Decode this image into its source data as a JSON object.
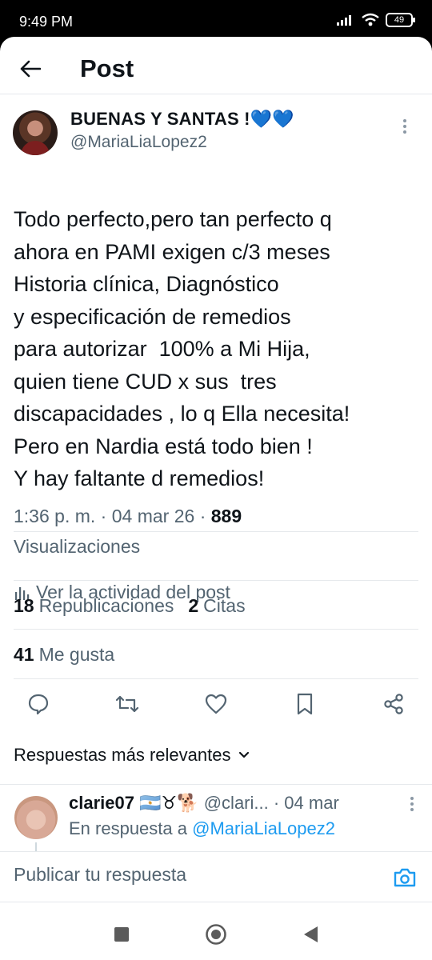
{
  "status_bar": {
    "time": "9:49 PM",
    "battery": "49"
  },
  "header": {
    "title": "Post"
  },
  "post": {
    "author_name": "BUENAS Y SANTAS !💙💙",
    "author_handle": "@MariaLiaLopez2",
    "text_lines": [
      "Todo perfecto,pero tan perfecto q",
      "ahora en PAMI exigen c/3 meses",
      "Historia clínica, Diagnóstico",
      "y especificación de remedios",
      "para autorizar  100% a Mi Hija,",
      "quien tiene CUD x sus  tres",
      "discapacidades , lo q Ella necesita!",
      "Pero en Nardia está todo bien !",
      "Y hay faltante d remedios!"
    ],
    "time": "1:36 p. m.",
    "date": "04 mar 26",
    "views_count": "889",
    "views_label": "Visualizaciones",
    "activity_label": "Ver la actividad del post",
    "reposts_count": "18",
    "reposts_label": "Republicaciones",
    "quotes_count": "2",
    "quotes_label": "Citas",
    "likes_count": "41",
    "likes_label": "Me gusta"
  },
  "replies": {
    "sort_label": "Respuestas más relevantes",
    "items": [
      {
        "name": "clarie07 🇦🇷♉🐕",
        "handle": "@clari...",
        "date": "· 04 mar",
        "reply_prefix": "En respuesta a",
        "reply_to": "@MariaLiaLopez2"
      }
    ]
  },
  "composer": {
    "placeholder": "Publicar tu respuesta"
  },
  "icons": {
    "back": "arrow-left-icon",
    "more": "more-vertical-icon",
    "reply": "reply-icon",
    "repost": "repost-icon",
    "like": "heart-icon",
    "bookmark": "bookmark-icon",
    "share": "share-icon",
    "camera": "camera-icon"
  },
  "colors": {
    "accent": "#1d9bf0",
    "text": "#0f1419",
    "secondary": "#536471",
    "border": "#e6e9ec"
  }
}
